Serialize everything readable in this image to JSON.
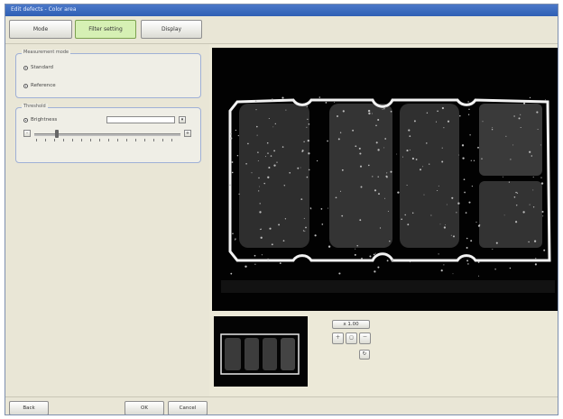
{
  "window": {
    "title": "Edit defects - Color area"
  },
  "tabs": [
    {
      "label": "Mode"
    },
    {
      "label": "Filter setting",
      "active": true
    },
    {
      "label": "Display"
    }
  ],
  "group_mode": {
    "title": "Measurement mode",
    "options": [
      {
        "label": "Standard",
        "selected": true
      },
      {
        "label": "Reference",
        "selected": true
      }
    ]
  },
  "group_threshold": {
    "title": "Threshold",
    "param_label": "Brightness",
    "value": "",
    "minus": "-",
    "plus": "+"
  },
  "zoom": {
    "label": "x 1.00",
    "icons": [
      "zoom-in-icon",
      "zoom-fit-icon",
      "zoom-out-icon",
      "refresh-icon"
    ]
  },
  "footer": {
    "back": "Back",
    "ok": "OK",
    "cancel": "Cancel"
  },
  "colors": {
    "accent_tab": "#d6f0b4",
    "titlebar": "#2f5fb4",
    "image_bg": "#020202"
  }
}
